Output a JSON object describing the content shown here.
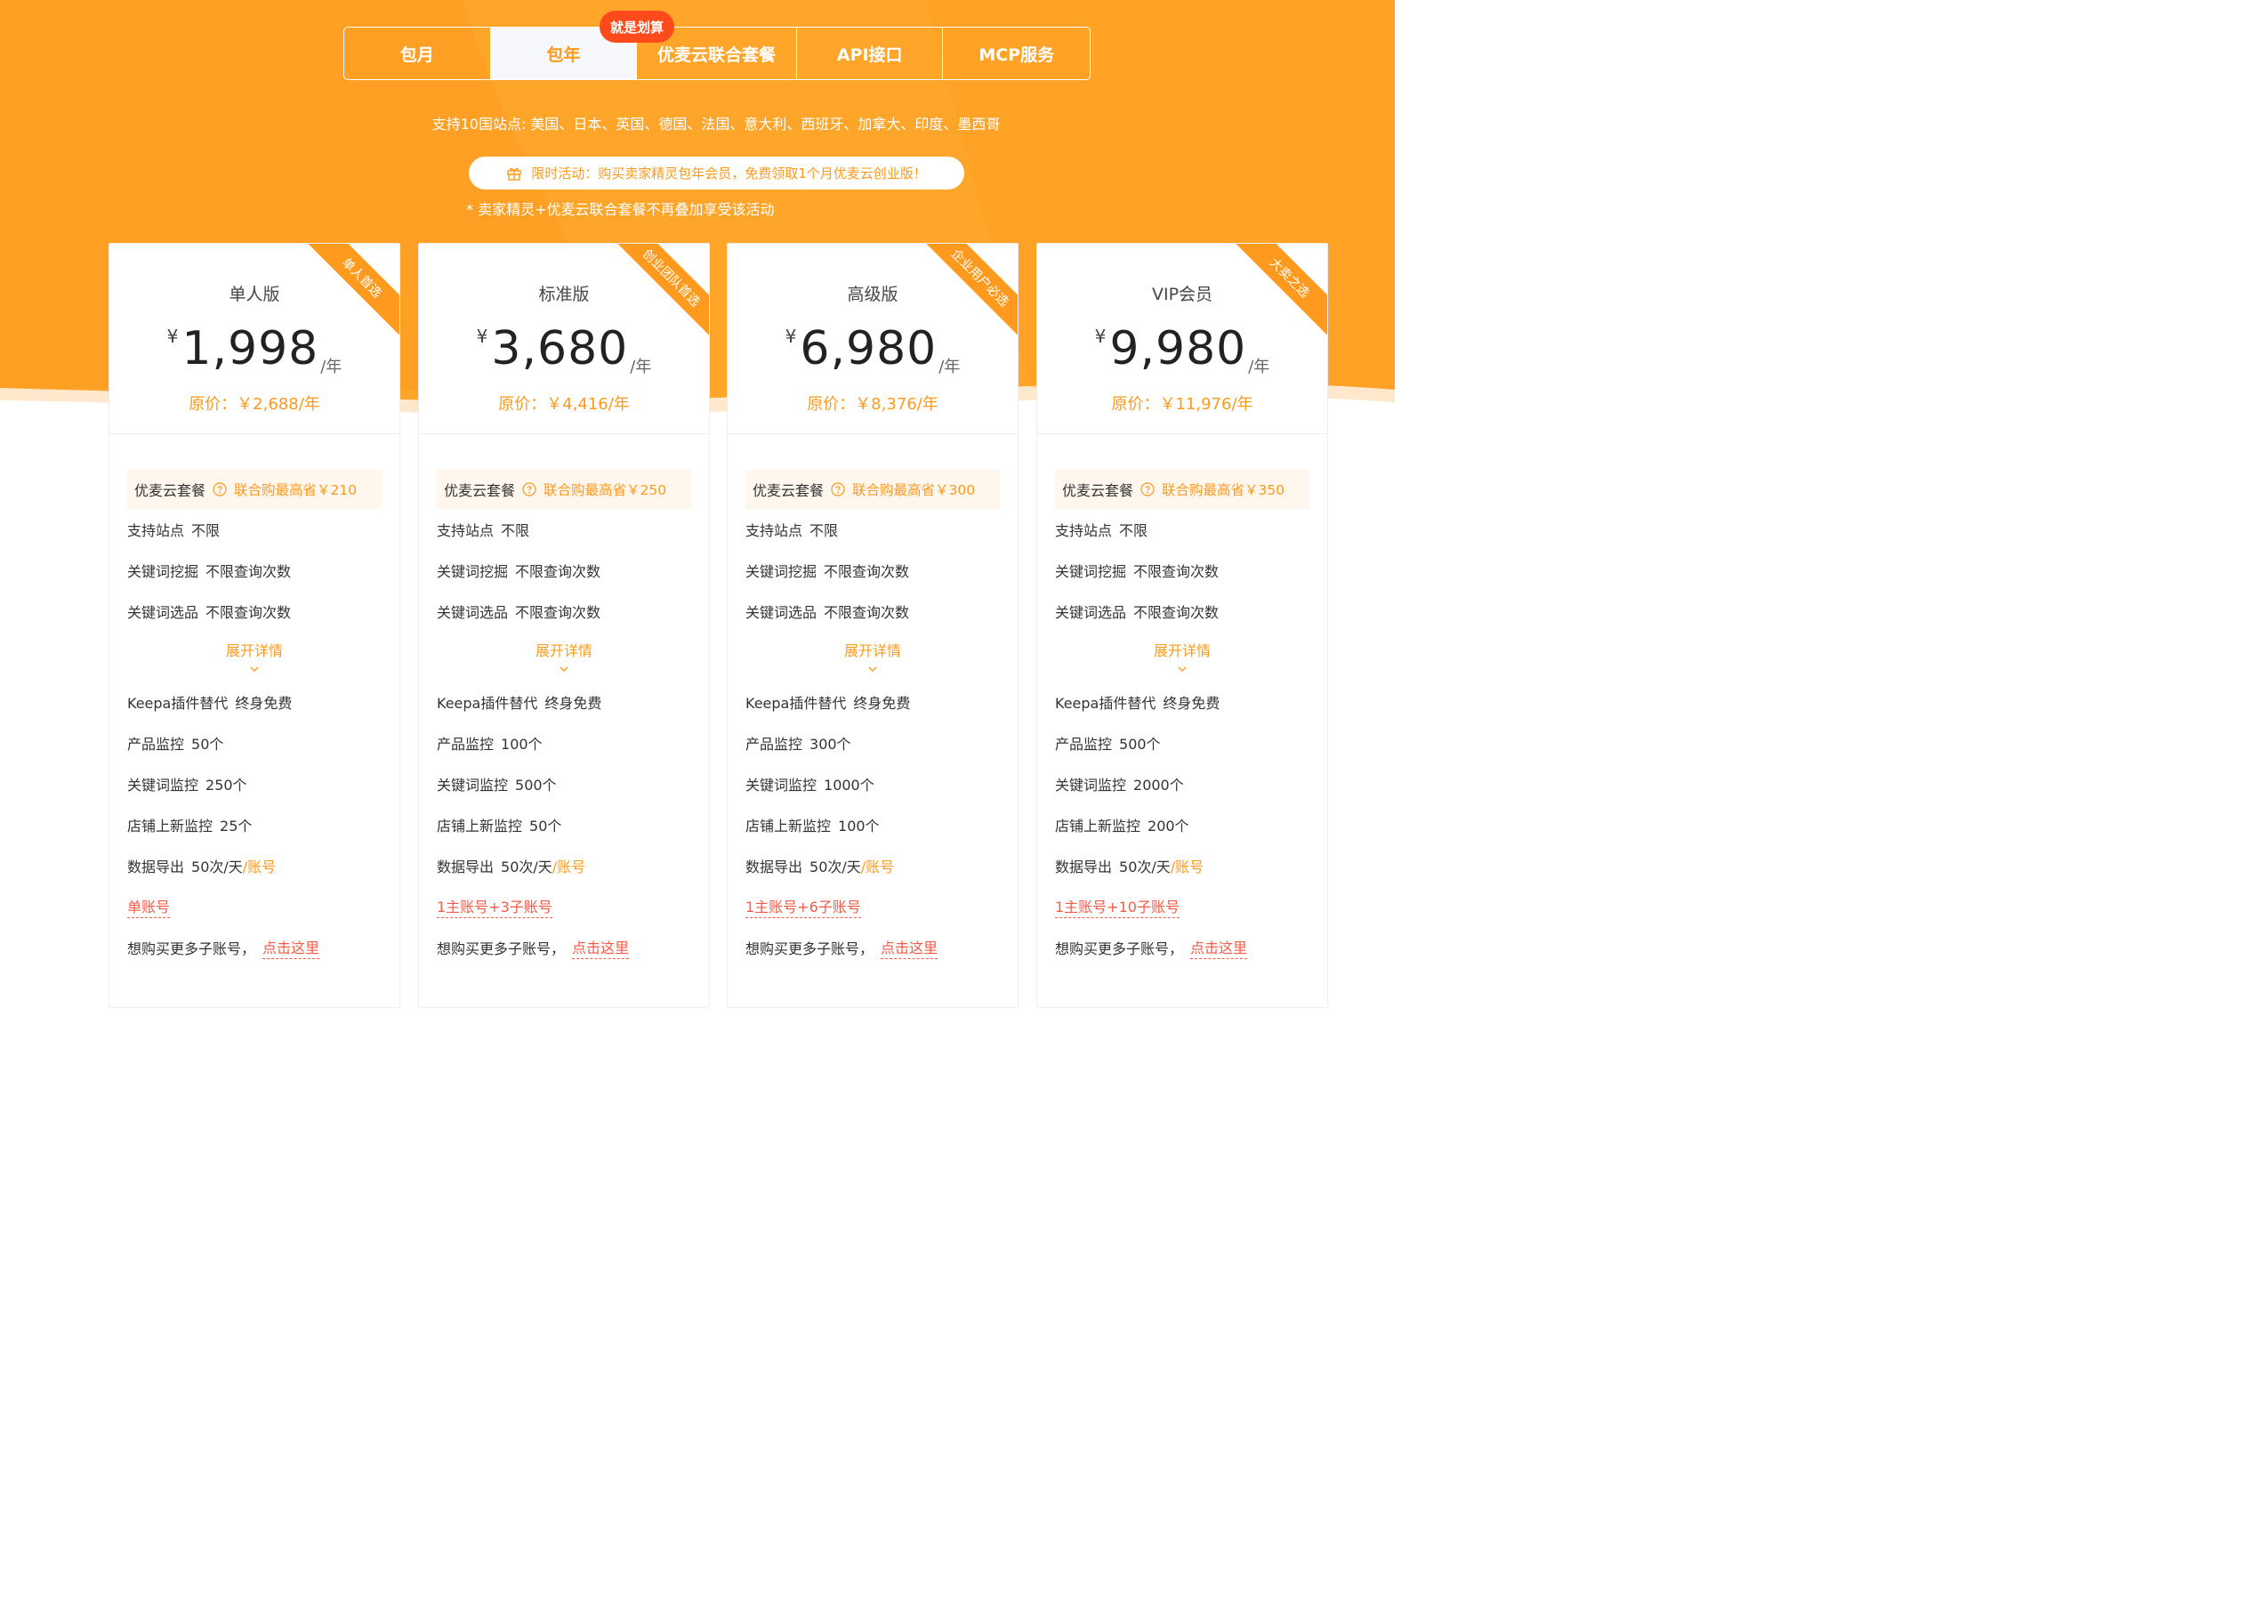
{
  "colors": {
    "accent": "#ff9a1f",
    "badge": "#ff4a1c",
    "link": "#f45a4a"
  },
  "tabs": [
    {
      "label": "包月"
    },
    {
      "label": "包年"
    },
    {
      "label": "优麦云联合套餐"
    },
    {
      "label": "API接口"
    },
    {
      "label": "MCP服务"
    }
  ],
  "hot_badge": "就是划算",
  "support_text": "支持10国站点: 美国、日本、英国、德国、法国、意大利、西班牙、加拿大、印度、墨西哥",
  "promo_text": "限时活动：购买卖家精灵包年会员，免费领取1个月优麦云创业版！",
  "note_text": "* 卖家精灵+优麦云联合套餐不再叠加享受该活动",
  "common": {
    "currency": "¥",
    "per_year": "/年",
    "combo_label": "优麦云套餐",
    "expand_label": "展开详情",
    "support_site": "支持站点",
    "unlimited": "不限",
    "keyword_mining": "关键词挖掘",
    "keyword_select": "关键词选品",
    "unlimited_queries": "不限查询次数",
    "keepa": "Keepa插件替代",
    "free_forever": "终身免费",
    "product_monitor": "产品监控",
    "keyword_monitor": "关键词监控",
    "shop_monitor": "店铺上新监控",
    "data_export": "数据导出",
    "export_value": "50次/天",
    "per_account": "/账号",
    "more_accounts": "想购买更多子账号，",
    "click_here": "点击这里"
  },
  "plans": [
    {
      "name": "单人版",
      "price": "1,998",
      "original": "原价：￥2,688/年",
      "ribbon": "单人首选",
      "combo_save": "联合购最高省￥210",
      "product_monitor": "50个",
      "keyword_monitor": "250个",
      "shop_monitor": "25个",
      "accounts": "单账号"
    },
    {
      "name": "标准版",
      "price": "3,680",
      "original": "原价：￥4,416/年",
      "ribbon": "创业团队首选",
      "combo_save": "联合购最高省￥250",
      "product_monitor": "100个",
      "keyword_monitor": "500个",
      "shop_monitor": "50个",
      "accounts": "1主账号+3子账号"
    },
    {
      "name": "高级版",
      "price": "6,980",
      "original": "原价：￥8,376/年",
      "ribbon": "企业用户必选",
      "combo_save": "联合购最高省￥300",
      "product_monitor": "300个",
      "keyword_monitor": "1000个",
      "shop_monitor": "100个",
      "accounts": "1主账号+6子账号"
    },
    {
      "name": "VIP会员",
      "price": "9,980",
      "original": "原价：￥11,976/年",
      "ribbon": "大卖之选",
      "combo_save": "联合购最高省￥350",
      "product_monitor": "500个",
      "keyword_monitor": "2000个",
      "shop_monitor": "200个",
      "accounts": "1主账号+10子账号"
    }
  ]
}
